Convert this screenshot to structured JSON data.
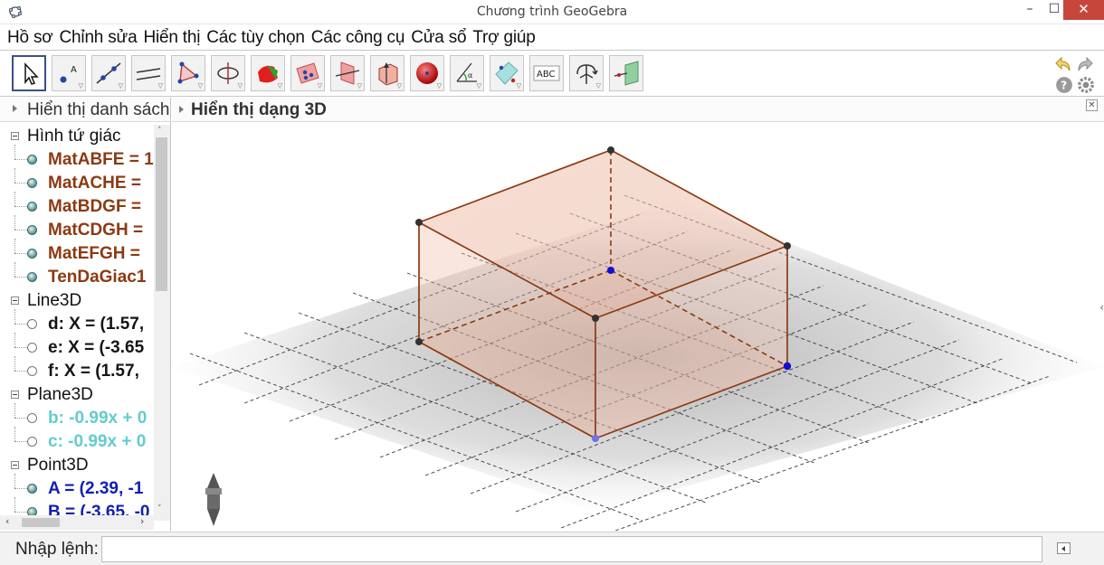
{
  "window": {
    "title": "Chương trình GeoGebra",
    "minimize": "–",
    "maximize": "☐",
    "close": "✕"
  },
  "menu": [
    "Hồ sơ",
    "Chỉnh sửa",
    "Hiển thị",
    "Các tùy chọn",
    "Các công cụ",
    "Cửa sổ",
    "Trợ giúp"
  ],
  "toolbar": {
    "tools": [
      {
        "name": "move-tool-icon"
      },
      {
        "name": "point-tool-icon"
      },
      {
        "name": "line-tool-icon"
      },
      {
        "name": "perpendicular-line-tool-icon"
      },
      {
        "name": "polygon-tool-icon"
      },
      {
        "name": "circle-axis-tool-icon"
      },
      {
        "name": "intersect-surfaces-tool-icon"
      },
      {
        "name": "plane-through-points-tool-icon"
      },
      {
        "name": "perpendicular-plane-tool-icon"
      },
      {
        "name": "pyramid-tool-icon"
      },
      {
        "name": "sphere-tool-icon"
      },
      {
        "name": "angle-tool-icon"
      },
      {
        "name": "reflect-plane-tool-icon"
      },
      {
        "name": "text-tool-icon",
        "label": "ABC"
      },
      {
        "name": "rotate-view-tool-icon"
      },
      {
        "name": "view-in-front-tool-icon"
      }
    ],
    "undo": "undo-icon",
    "redo": "redo-icon",
    "help": "help-icon",
    "settings": "gear-icon"
  },
  "algebra": {
    "header": "Hiển thị danh sách",
    "groups": [
      {
        "label": "Hình tứ giác",
        "items": [
          {
            "text": "MatABFE = 1",
            "color": "brown",
            "dot": "filled"
          },
          {
            "text": "MatACHE = ",
            "color": "brown",
            "dot": "filled"
          },
          {
            "text": "MatBDGF = ",
            "color": "brown",
            "dot": "filled"
          },
          {
            "text": "MatCDGH = ",
            "color": "brown",
            "dot": "filled"
          },
          {
            "text": "MatEFGH = ",
            "color": "brown",
            "dot": "filled"
          },
          {
            "text": "TenDaGiac1",
            "color": "brown",
            "dot": "filled"
          }
        ]
      },
      {
        "label": "Line3D",
        "items": [
          {
            "text": "d: X = (1.57, ",
            "color": "black",
            "dot": "hollow"
          },
          {
            "text": "e: X = (-3.65",
            "color": "black",
            "dot": "hollow"
          },
          {
            "text": "f: X = (1.57, ",
            "color": "black",
            "dot": "hollow"
          }
        ]
      },
      {
        "label": "Plane3D",
        "items": [
          {
            "text": "b: -0.99x + 0",
            "color": "cyan",
            "dot": "hollow"
          },
          {
            "text": "c: -0.99x + 0",
            "color": "cyan",
            "dot": "hollow"
          }
        ]
      },
      {
        "label": "Point3D",
        "items": [
          {
            "text": "A = (2.39, -1",
            "color": "blue",
            "dot": "filled"
          },
          {
            "text": "B = (-3.65, -0",
            "color": "blue",
            "dot": "filled"
          }
        ]
      }
    ]
  },
  "view3d": {
    "header": "Hiển thị dạng 3D",
    "close": "✕"
  },
  "input": {
    "label": "Nhập lệnh:",
    "value": "",
    "placeholder": ""
  },
  "colors": {
    "edge": "#8b3a12",
    "face": "#e9a990",
    "grid": "#444444",
    "point_dark": "#333333",
    "point_blue": "#1010d0",
    "point_light": "#7070ee"
  }
}
